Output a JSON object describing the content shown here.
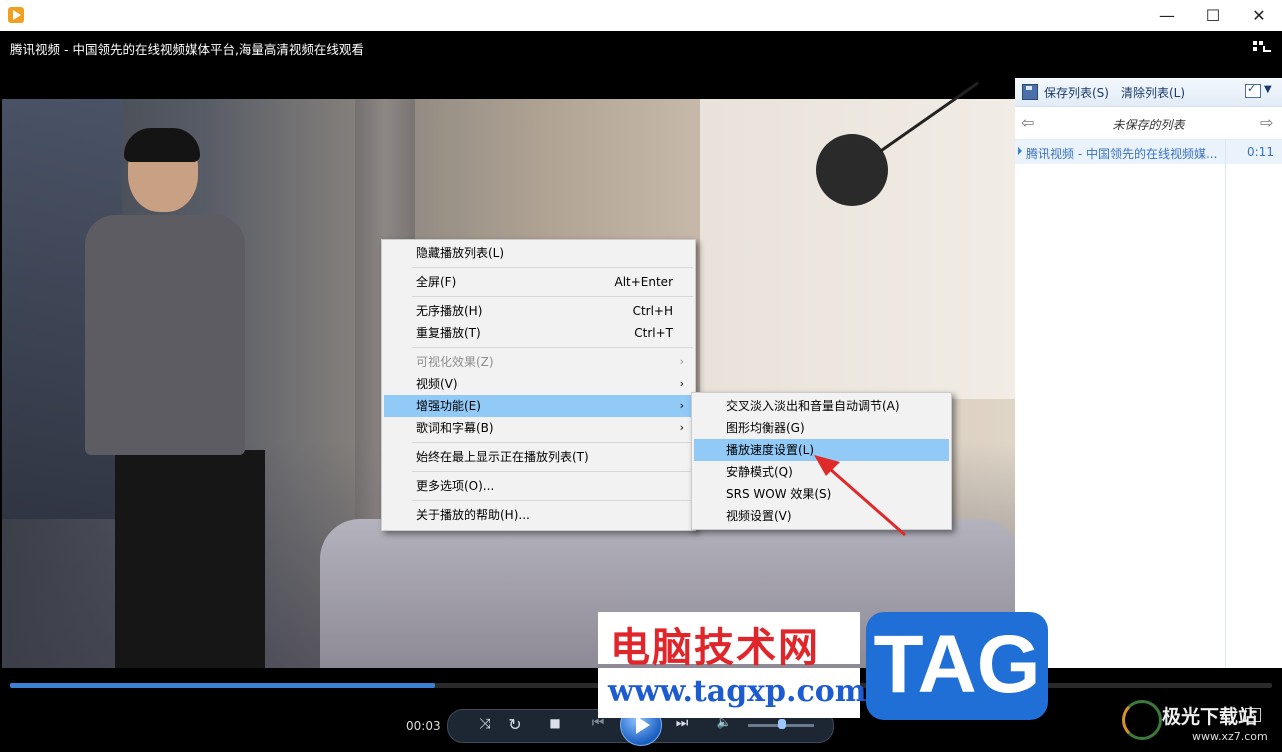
{
  "titlebar": {
    "minimize": "—",
    "maximize": "☐",
    "close": "✕"
  },
  "video": {
    "title": "腾讯视频 - 中国领先的在线视频媒体平台,海量高清视频在线观看"
  },
  "context_menu": {
    "items": [
      {
        "label": "隐藏播放列表(L)",
        "shortcut": "",
        "disabled": false
      },
      {
        "label": "全屏(F)",
        "shortcut": "Alt+Enter",
        "disabled": false
      },
      {
        "label": "无序播放(H)",
        "shortcut": "Ctrl+H",
        "disabled": false
      },
      {
        "label": "重复播放(T)",
        "shortcut": "Ctrl+T",
        "disabled": false
      },
      {
        "label": "可视化效果(Z)",
        "shortcut": "",
        "disabled": true
      },
      {
        "label": "视频(V)",
        "shortcut": "",
        "disabled": false
      },
      {
        "label": "增强功能(E)",
        "shortcut": "",
        "disabled": false,
        "highlighted": true
      },
      {
        "label": "歌词和字幕(B)",
        "shortcut": "",
        "disabled": false
      },
      {
        "label": "始终在最上显示正在播放列表(T)",
        "shortcut": "",
        "disabled": false
      },
      {
        "label": "更多选项(O)...",
        "shortcut": "",
        "disabled": false
      },
      {
        "label": "关于播放的帮助(H)...",
        "shortcut": "",
        "disabled": false
      }
    ],
    "arrow": "›"
  },
  "submenu": {
    "items": [
      {
        "label": "交叉淡入淡出和音量自动调节(A)"
      },
      {
        "label": "图形均衡器(G)"
      },
      {
        "label": "播放速度设置(L)",
        "highlighted": true
      },
      {
        "label": "安静模式(Q)"
      },
      {
        "label": "SRS WOW 效果(S)"
      },
      {
        "label": "视频设置(V)"
      }
    ]
  },
  "playlist": {
    "save_label": "保存列表(S)",
    "clear_label": "清除列表(L)",
    "list_name": "未保存的列表",
    "nav_back": "⇦",
    "nav_forward": "⇨",
    "options_arrow": "▼",
    "items": [
      {
        "title": "腾讯视频 - 中国领先的在线视频媒...",
        "duration": "0:11"
      }
    ]
  },
  "controls": {
    "time": "00:03",
    "progress": 0.337,
    "volume": 0.52,
    "shuffle": "⤨",
    "repeat": "↻",
    "stop": "■",
    "prev": "⏮",
    "next": "⏭",
    "mute": "🔈",
    "fullscreen": "⇱"
  },
  "watermark": {
    "site_cn": "电脑技术网",
    "site_url": "www.tagxp.com",
    "tag": "TAG",
    "site2_cn": "极光下载站",
    "site2_url": "www.xz7.com"
  },
  "colors": {
    "accent": "#3e7fd6",
    "menu_highlight": "#91c9f7",
    "watermark_red": "#e0262a",
    "watermark_blue": "#1f6fd7"
  }
}
